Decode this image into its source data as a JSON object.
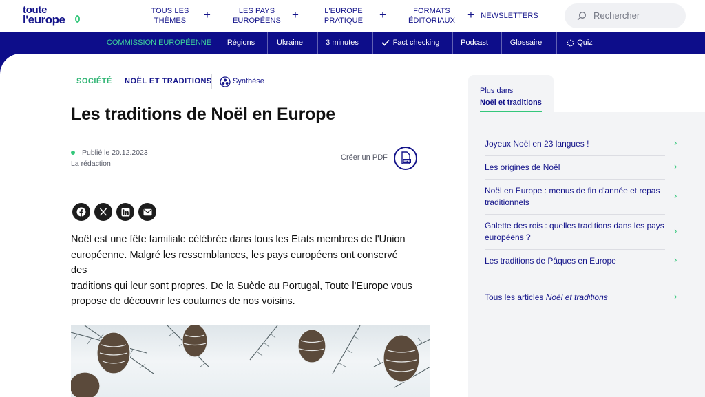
{
  "header": {
    "logo_line1": "toute",
    "logo_line2": "l'europe",
    "nav": [
      {
        "label_line1": "TOUS LES THÈMES",
        "label_line2": ""
      },
      {
        "label_line1": "LES PAYS",
        "label_line2": "EUROPÉENS"
      },
      {
        "label_line1": "L'EUROPE",
        "label_line2": "PRATIQUE"
      },
      {
        "label_line1": "FORMATS",
        "label_line2": "ÉDITORIAUX"
      },
      {
        "label_line1": "NEWSLETTERS",
        "label_line2": ""
      }
    ],
    "plus": "+",
    "search_placeholder": "Rechercher"
  },
  "subnav": {
    "items": [
      "COMMISSION EUROPÉENNE",
      "Régions",
      "Ukraine",
      "3 minutes",
      "Fact checking",
      "Podcast",
      "Glossaire",
      "Quiz"
    ]
  },
  "article": {
    "tags": [
      "SOCIÉTÉ",
      "NOËL ET TRADITIONS",
      "Synthèse"
    ],
    "title": "Les traditions de Noël en Europe",
    "published": "Publié le 20.12.2023",
    "author": "La rédaction",
    "pdf_label": "Créer un PDF",
    "pdf_icon_text": "PDF",
    "lead_lines": [
      "Noël est une fête familiale célébrée dans tous les Etats membres de l'Union",
      "européenne. Malgré les ressemblances, les pays européens ont conservé des",
      "traditions qui leur sont propres. De la Suède au Portugal, Toute l'Europe vous",
      "propose de découvrir les coutumes de nos voisins."
    ],
    "share_icons": [
      "facebook-icon",
      "x-icon",
      "linkedin-icon",
      "email-icon"
    ]
  },
  "sidebar": {
    "tab_line1": "Plus dans",
    "tab_line2": "Noël et traditions",
    "links": [
      {
        "line1": "Joyeux Noël en 23 langues !",
        "line2": ""
      },
      {
        "line1": "Les origines de Noël",
        "line2": ""
      },
      {
        "line1": "Noël en Europe : menus de fin d'année et repas",
        "line2": "traditionnels"
      },
      {
        "line1": "Galette des rois : quelles traditions dans les pays",
        "line2": "européens ?"
      },
      {
        "line1": "Les traditions de Pâques en Europe",
        "line2": ""
      }
    ],
    "all_prefix": "Tous les articles ",
    "all_topic": "Noël et traditions",
    "arrow": "›"
  },
  "colors": {
    "brand_blue": "#14148a",
    "subnav_blue": "#0d0d8a",
    "accent_green": "#34c77b"
  }
}
